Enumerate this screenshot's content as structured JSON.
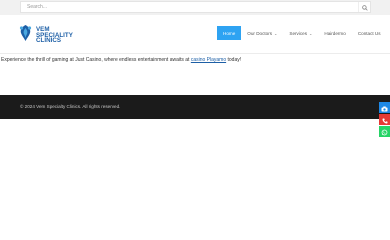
{
  "search": {
    "placeholder": "Search..."
  },
  "brand": {
    "line1": "VEM",
    "line2": "SPECIALITY",
    "line3": "CLINICS"
  },
  "nav": {
    "items": [
      {
        "label": "Home"
      },
      {
        "label": "Our Doctors"
      },
      {
        "label": "Services"
      },
      {
        "label": "Hairdermo"
      },
      {
        "label": "Contact Us"
      }
    ]
  },
  "content": {
    "text_before": "Experience the thrill of gaming at Just Casino, where endless entertainment awaits at ",
    "link_text": "casino Playamo",
    "text_after": " today!"
  },
  "footer": {
    "copyright": "© 2024 Vem Specialty Clinics. All rights reserved."
  },
  "colors": {
    "accent": "#2ea3f2",
    "brand": "#1d5fa6",
    "footer_bg": "#1b1b1b",
    "camera_btn": "#1e88e5",
    "phone_btn": "#e53935",
    "whatsapp_btn": "#25d366"
  },
  "icons": {
    "search": "search-icon",
    "logo": "hands-logo-icon",
    "camera": "camera-icon",
    "phone": "phone-icon",
    "whatsapp": "whatsapp-icon"
  }
}
